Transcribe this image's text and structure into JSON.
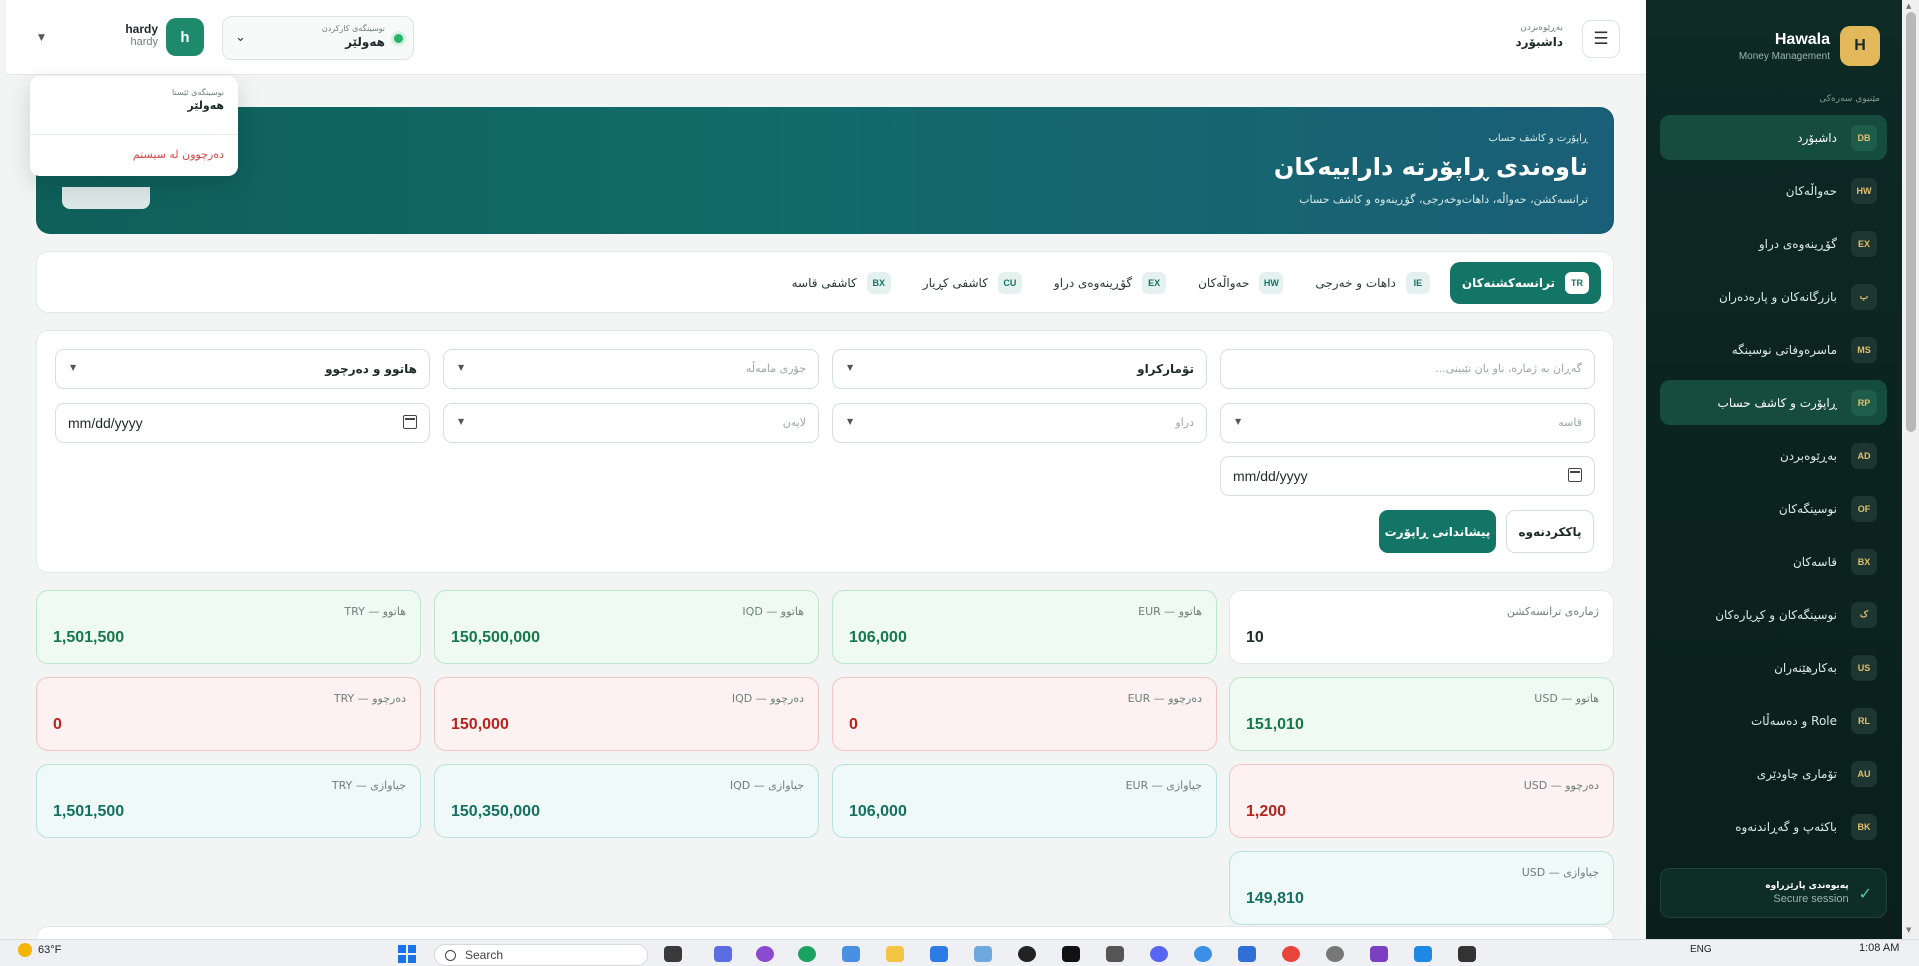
{
  "brand": {
    "logo_letter": "H",
    "name": "Hawala",
    "subtitle": "Money Management"
  },
  "sidebar": {
    "section_title": "مێنیوی سەرەکی",
    "items": [
      {
        "badge": "DB",
        "label": "داشبۆرد",
        "active": true
      },
      {
        "badge": "HW",
        "label": "حەواڵەکان",
        "active": false
      },
      {
        "badge": "EX",
        "label": "گۆڕینەوەی دراو",
        "active": false
      },
      {
        "badge": "ب",
        "label": "بازرگانەکان و پارەدەران",
        "active": false
      },
      {
        "badge": "MS",
        "label": "ماسرەوفاتی نوسینگە",
        "active": false
      },
      {
        "badge": "RP",
        "label": "ڕاپۆرت و کاشف حساب",
        "active": true
      },
      {
        "badge": "AD",
        "label": "بەڕێوەبردن",
        "active": false
      },
      {
        "badge": "OF",
        "label": "نوسینگەکان",
        "active": false
      },
      {
        "badge": "BX",
        "label": "قاسەکان",
        "active": false
      },
      {
        "badge": "ک",
        "label": "نوسینگەکان و کڕیارەکان",
        "active": false
      },
      {
        "badge": "US",
        "label": "بەکارهێنەران",
        "active": false
      },
      {
        "badge": "RL",
        "label": "Role و دەسەڵات",
        "active": false
      },
      {
        "badge": "AU",
        "label": "تۆماری چاودێری",
        "active": false
      },
      {
        "badge": "BK",
        "label": "باکئەپ و گەڕاندنەوە",
        "active": false
      }
    ],
    "secure": {
      "title": "پەیوەندی پارێزراوە",
      "subtitle": "Secure session"
    }
  },
  "header": {
    "menu_icon": "☰",
    "breadcrumb_small": "بەڕێوەبردن",
    "breadcrumb_title": "داشبۆرد",
    "office": {
      "small": "نوسینگەی کارکردن",
      "name": "هەولێر"
    },
    "user": {
      "avatar": "h",
      "name": "hardy",
      "role": "hardy"
    },
    "user_menu": {
      "small": "نوسینگەی ئێستا",
      "name": "هەولێر",
      "logout": "دەرچوون لە سیستم"
    }
  },
  "hero": {
    "small": "ڕاپۆرت و کاشف حساب",
    "title": "ناوەندی ڕاپۆرتە داراییەکان",
    "subtitle": "ترانسەکشن، حەواڵە، داهات‌وخەرجی، گۆڕینەوە و کاشف حساب"
  },
  "tabs": [
    {
      "badge": "TR",
      "label": "ترانسەکشنەکان",
      "active": true
    },
    {
      "badge": "IE",
      "label": "داهات و خەرجی",
      "active": false
    },
    {
      "badge": "HW",
      "label": "حەواڵەکان",
      "active": false
    },
    {
      "badge": "EX",
      "label": "گۆڕینەوەی دراو",
      "active": false
    },
    {
      "badge": "CU",
      "label": "کاشفی کڕیار",
      "active": false
    },
    {
      "badge": "BX",
      "label": "کاشفی قاسە",
      "active": false
    }
  ],
  "filters": {
    "search_placeholder": "گەڕان بە ژمارە، ناو یان تێبینی...",
    "ledger_value": "تۆمارکراو",
    "type_placeholder": "جۆری مامەڵە",
    "direction_value": "هاتوو و دەرچوو",
    "box_placeholder": "قاسە",
    "currency_placeholder": "دراو",
    "side_placeholder": "لایەن",
    "date_from": "mm/dd/yyyy",
    "date_to": "mm/dd/yyyy",
    "generate_label": "پیشاندانی ڕاپۆرت",
    "clear_label": "پاککردنەوە"
  },
  "stats": {
    "tx_count": {
      "label": "ژمارەی ترانسەکشن",
      "value": "10"
    },
    "in_eur": {
      "label": "هاتوو — EUR",
      "value": "106,000"
    },
    "in_iqd": {
      "label": "هاتوو — IQD",
      "value": "150,500,000"
    },
    "in_try": {
      "label": "هاتوو — TRY",
      "value": "1,501,500"
    },
    "in_usd": {
      "label": "هاتوو — USD",
      "value": "151,010"
    },
    "out_eur": {
      "label": "دەرچوو — EUR",
      "value": "0"
    },
    "out_iqd": {
      "label": "دەرچوو — IQD",
      "value": "150,000"
    },
    "out_try": {
      "label": "دەرچوو — TRY",
      "value": "0"
    },
    "out_usd": {
      "label": "دەرچوو — USD",
      "value": "1,200"
    },
    "diff_eur": {
      "label": "جیاوازی — EUR",
      "value": "106,000"
    },
    "diff_iqd": {
      "label": "جیاوازی — IQD",
      "value": "150,350,000"
    },
    "diff_try": {
      "label": "جیاوازی — TRY",
      "value": "1,501,500"
    },
    "diff_usd": {
      "label": "جیاوازی — USD",
      "value": "149,810"
    }
  },
  "taskbar": {
    "temperature": "63°F",
    "search": "Search",
    "lang": "ENG",
    "time": "1:08 AM"
  }
}
